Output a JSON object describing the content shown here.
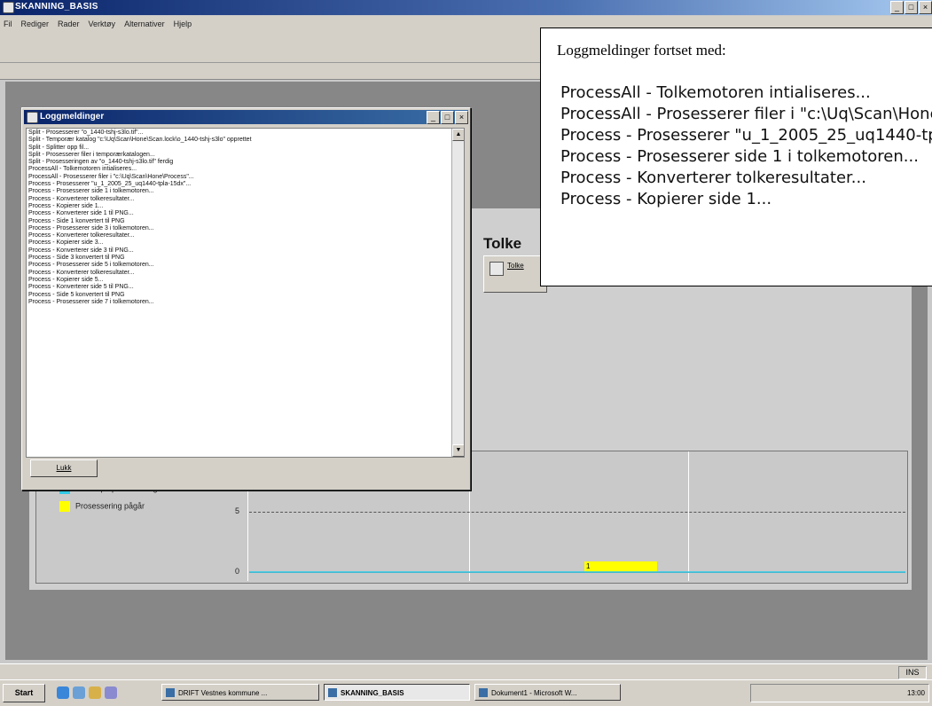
{
  "app": {
    "title": "SKANNING_BASIS"
  },
  "menu": [
    "Fil",
    "Rediger",
    "Rader",
    "Verktøy",
    "Alternativer",
    "Hjelp"
  ],
  "tolke": {
    "title": "Tolke",
    "button_label": "Tolke"
  },
  "logg": {
    "title": "Loggmeldinger",
    "lines": [
      "Split - Prosesserer \"o_1440-tshj-s3lo.tif\"...",
      "Split - Temporær katalog \"c:\\Uq\\Scan\\Hone\\Scan.lock\\o_1440-tshj-s3lo\" opprettet",
      "Split - Splitter opp fil...",
      "Split - Prosesserer filer i temporærkatalogen...",
      "Split - Prosesseringen av \"o_1440-tshj-s3lo.tif\" ferdig",
      "ProcessAll - Tolkemotoren intialiseres...",
      "ProcessAll - Prosesserer filer i \"c:\\Uq\\Scan\\Hone\\Process\"...",
      "Process - Prosesserer \"u_1_2005_25_uq1440-tpla-15dx\"...",
      "Process - Prosesserer side 1 i tolkemotoren...",
      "Process - Konverterer tolkeresultater...",
      "Process - Kopierer side 1...",
      "Process - Konverterer side 1 til PNG...",
      "Process - Side 1 konvertert til PNG",
      "Process - Prosesserer side 3 i tolkemotoren...",
      "Process - Konverterer tolkeresultater...",
      "Process - Kopierer side 3...",
      "Process - Konverterer side 3 til PNG...",
      "Process - Side 3 konvertert til PNG",
      "Process - Prosesserer side 5 i tolkemotoren...",
      "Process - Konverterer tolkeresultater...",
      "Process - Kopierer side 5...",
      "Process - Konverterer side 5 til PNG...",
      "Process - Side 5 konvertert til PNG",
      "Process - Prosesserer side 7 i tolkemotoren..."
    ],
    "close_label": "Lukk"
  },
  "chart": {
    "legend": [
      {
        "label": "Venter på prosessering",
        "color": "#33c9e6"
      },
      {
        "label": "Prosessering pågår",
        "color": "#ffff00"
      }
    ],
    "yticks": [
      "5",
      "0"
    ],
    "bar_label": "1"
  },
  "callout": {
    "heading": "Loggmeldinger fortset med:",
    "lines": [
      "ProcessAll - Tolkemotoren intialiseres...",
      "ProcessAll - Prosesserer filer i \"c:\\Uq\\Scan\\Hone\\Process\"...",
      "Process - Prosesserer \"u_1_2005_25_uq1440-tpla-15dx\"...",
      "Process - Prosesserer side 1 i tolkemotoren...",
      "Process - Konverterer tolkeresultater...",
      "Process - Kopierer side 1..."
    ]
  },
  "status": {
    "ins": "INS"
  },
  "taskbar": {
    "start": "Start",
    "tasks": [
      "DRIFT Vestnes kommune ...",
      "SKANNING_BASIS",
      "Dokument1 - Microsoft W..."
    ],
    "clock": "13:00"
  }
}
